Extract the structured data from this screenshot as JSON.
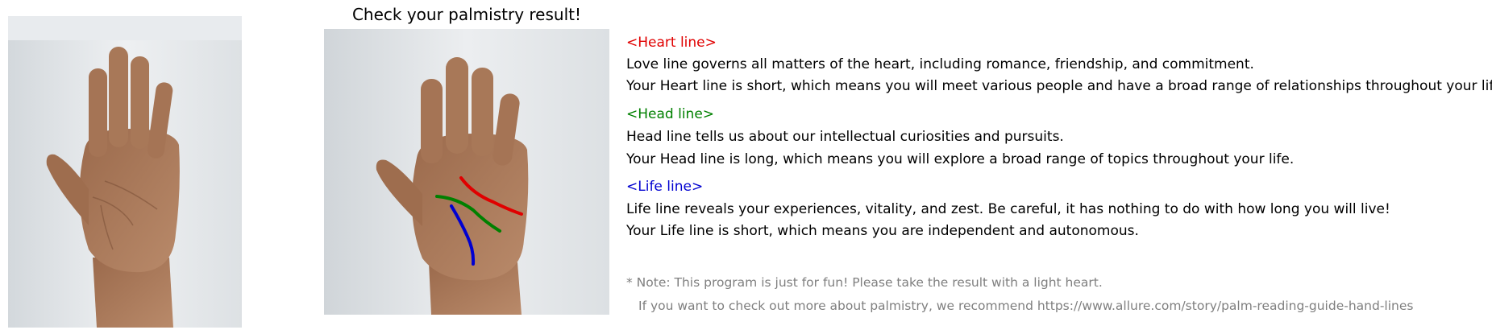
{
  "title": "Check your palmistry result!",
  "colors": {
    "heart": "#e00000",
    "head": "#008000",
    "life": "#0000d0",
    "note": "#7f7f7f"
  },
  "sections": [
    {
      "key": "heart",
      "heading": "<Heart line>",
      "desc": "Love line governs all matters of the heart, including romance, friendship, and commitment.",
      "result": "Your Heart line is short, which means you will meet various people and have a broad range of relationships throughout your life."
    },
    {
      "key": "head",
      "heading": "<Head line>",
      "desc": "Head line tells us about our intellectual curiosities and pursuits.",
      "result": "Your Head line is long, which means you will explore a broad range of topics throughout your life."
    },
    {
      "key": "life",
      "heading": "<Life line>",
      "desc": "Life line reveals your experiences, vitality, and zest. Be careful, it has nothing to do with how long you will live!",
      "result": "Your Life line is short, which means you are independent and autonomous."
    }
  ],
  "note": {
    "line1": "* Note: This program is just for fun! Please take the result with a light heart.",
    "line2": "If you want to check out more about palmistry, we recommend https://www.allure.com/story/palm-reading-guide-hand-lines"
  }
}
